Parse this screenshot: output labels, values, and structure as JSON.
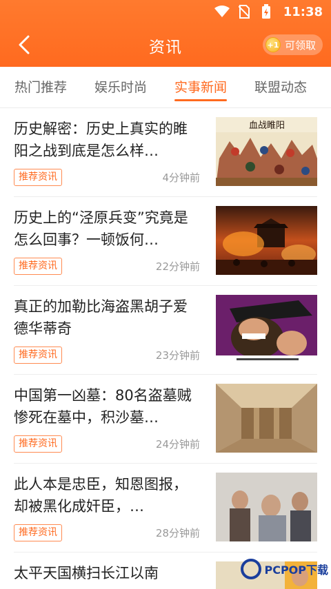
{
  "status": {
    "time": "11:38"
  },
  "header": {
    "title": "资讯",
    "claim_label": "可领取",
    "coin_label": "+1"
  },
  "tabs": [
    {
      "label": "热门推荐",
      "active": false
    },
    {
      "label": "娱乐时尚",
      "active": false
    },
    {
      "label": "实事新闻",
      "active": true
    },
    {
      "label": "联盟动态",
      "active": false
    }
  ],
  "articles": [
    {
      "title": "历史解密：历史上真实的睢阳之战到底是怎么样…",
      "tag": "推荐资讯",
      "ago": "4分钟前",
      "thumb_caption": "血战睢阳"
    },
    {
      "title": "历史上的“泾原兵变”究竟是怎么回事？一顿饭何…",
      "tag": "推荐资讯",
      "ago": "22分钟前"
    },
    {
      "title": "真正的加勒比海盗黑胡子爱德华蒂奇",
      "tag": "推荐资讯",
      "ago": "23分钟前"
    },
    {
      "title": "中国第一凶墓：80名盗墓贼惨死在墓中，积沙墓…",
      "tag": "推荐资讯",
      "ago": "24分钟前"
    },
    {
      "title": "此人本是忠臣，知恩图报，却被黑化成奸臣，…",
      "tag": "推荐资讯",
      "ago": "28分钟前"
    },
    {
      "title": "太平天国横扫长江以南"
    }
  ],
  "watermark": {
    "text": "PCPOP下载"
  },
  "colors": {
    "accent": "#ff6a1f",
    "header": "#ff7a2e"
  }
}
